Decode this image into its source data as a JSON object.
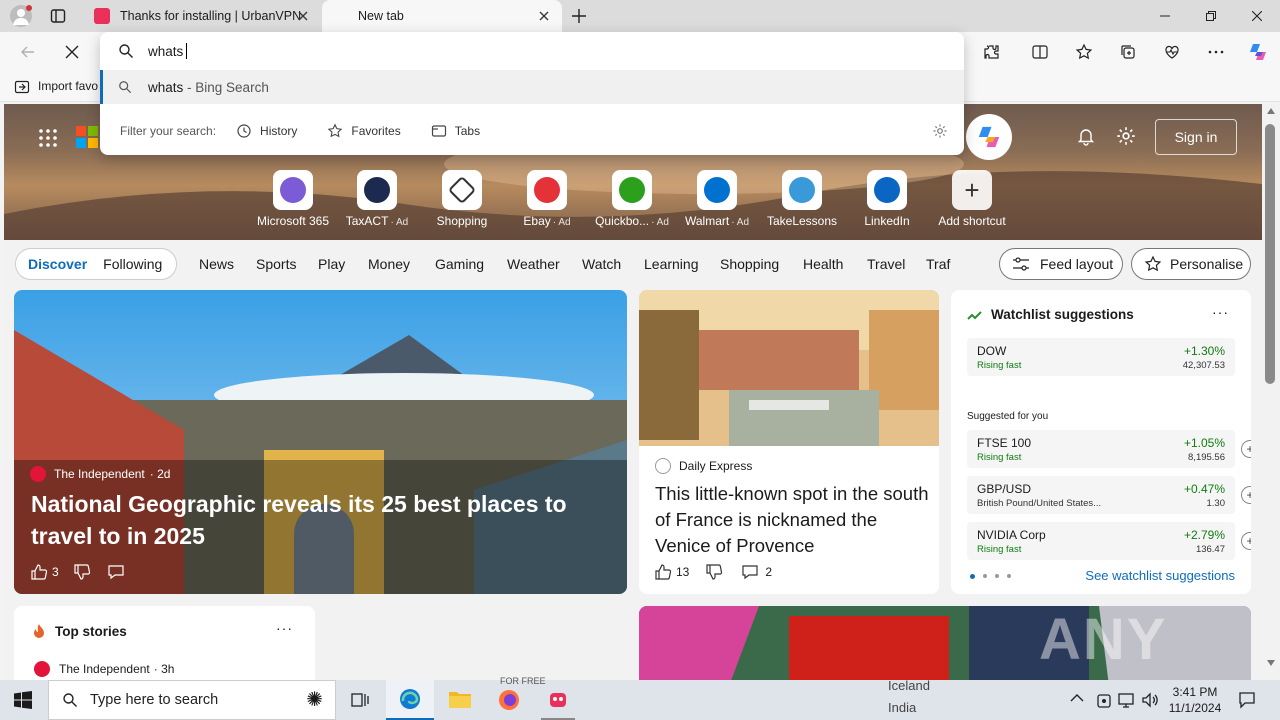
{
  "tabs": [
    {
      "label": "Thanks for installing | UrbanVPN",
      "active": false
    },
    {
      "label": "New tab",
      "active": true
    }
  ],
  "omnibox": {
    "query": "whats",
    "suggestion_term": "whats",
    "suggestion_suffix": " - Bing Search",
    "filter_label": "Filter your search:",
    "filters": [
      "History",
      "Favorites",
      "Tabs"
    ]
  },
  "favbar": {
    "import_label": "Import favo"
  },
  "page": {
    "sign_in": "Sign in",
    "shortcuts": [
      {
        "label": "Microsoft 365",
        "ad": "",
        "icon": "m365-icon",
        "color": "#7b5cd6"
      },
      {
        "label": "TaxACT",
        "ad": "· Ad",
        "icon": "taxact-icon",
        "color": "#1b2a4e"
      },
      {
        "label": "Shopping",
        "ad": "",
        "icon": "tag-icon",
        "color": "#ffffff"
      },
      {
        "label": "Ebay",
        "ad": "· Ad",
        "icon": "ebay-icon",
        "color": "#e53238"
      },
      {
        "label": "Quickbo...",
        "ad": "· Ad",
        "icon": "quickbooks-icon",
        "color": "#2ca01c"
      },
      {
        "label": "Walmart",
        "ad": "· Ad",
        "icon": "walmart-icon",
        "color": "#0071ce"
      },
      {
        "label": "TakeLessons",
        "ad": "",
        "icon": "takelessons-icon",
        "color": "#3a9ad9"
      },
      {
        "label": "LinkedIn",
        "ad": "",
        "icon": "linkedin-icon",
        "color": "#0a66c2"
      },
      {
        "label": "Add shortcut",
        "ad": "",
        "icon": "plus-icon",
        "color": "#ffffff"
      }
    ],
    "feed_tabs": [
      "Discover",
      "Following"
    ],
    "nav": [
      "News",
      "Sports",
      "Play",
      "Money",
      "Gaming",
      "Weather",
      "Watch",
      "Learning",
      "Shopping",
      "Health",
      "Travel",
      "Traf"
    ],
    "feed_layout": "Feed layout",
    "personalise": "Personalise",
    "main_card": {
      "source": "The Independent",
      "age": "· 2d",
      "title": "National Geographic reveals its 25 best places to travel to in 2025",
      "likes": "3"
    },
    "second_card": {
      "source": "Daily Express",
      "title": "This little-known spot in the south of France is nicknamed the Venice of Provence",
      "likes": "13",
      "comments": "2"
    },
    "watchlist": {
      "title": "Watchlist suggestions",
      "top": {
        "name": "DOW",
        "sub": "Rising fast",
        "change": "+1.30%",
        "price": "42,307.53"
      },
      "suggested_label": "Suggested for you",
      "items": [
        {
          "name": "FTSE 100",
          "sub": "Rising fast",
          "change": "+1.05%",
          "price": "8,195.56"
        },
        {
          "name": "GBP/USD",
          "sub": "British Pound/United States...",
          "change": "+0.47%",
          "price": "1.30"
        },
        {
          "name": "NVIDIA Corp",
          "sub": "Rising fast",
          "change": "+2.79%",
          "price": "136.47"
        }
      ],
      "see_more": "See watchlist suggestions"
    },
    "top_stories": {
      "title": "Top stories",
      "source": "The Independent",
      "age": "· 3h"
    },
    "watermark": "ANY RUN",
    "bottom_text": [
      "FOR FREE",
      "Iceland",
      "India"
    ]
  },
  "taskbar": {
    "search_placeholder": "Type here to search",
    "time": "3:41 PM",
    "date": "11/1/2024"
  },
  "colors": {
    "accent": "#0f6cbd",
    "green": "#107c10",
    "rising": "#2e8b2e"
  }
}
